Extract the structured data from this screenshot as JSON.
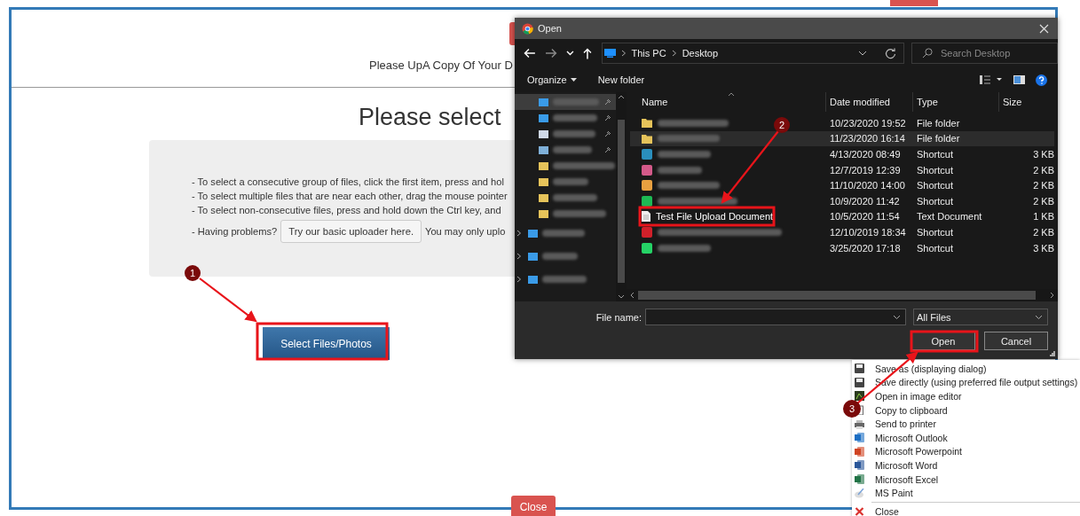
{
  "page": {
    "header_text": "Please UpA Copy Of Your D",
    "heading": "Please select",
    "instructions": [
      "- To select a consecutive group of files, click the first item, press and hol",
      "- To select multiple files that are near each other, drag the mouse pointer",
      "- To select non-consecutive files, press and hold down the Ctrl key, and"
    ],
    "problems_label": "- Having problems?",
    "basic_uploader_button": "Try our basic uploader here.",
    "problems_note": "You may only uplo",
    "select_button": "Select Files/Photos",
    "close_button": "Close"
  },
  "dialog": {
    "title": "Open",
    "breadcrumb": [
      "This PC",
      "Desktop"
    ],
    "search": {
      "placeholder": "Search Desktop"
    },
    "toolbar": {
      "organize": "Organize",
      "new_folder": "New folder"
    },
    "nav_pane": [
      {
        "kind": "desktop",
        "selected": true,
        "pinned": true,
        "expandable": false
      },
      {
        "kind": "downloads",
        "selected": false,
        "pinned": true,
        "expandable": false
      },
      {
        "kind": "documents",
        "selected": false,
        "pinned": true,
        "expandable": false
      },
      {
        "kind": "pictures",
        "selected": false,
        "pinned": true,
        "expandable": false
      },
      {
        "kind": "folder",
        "selected": false,
        "pinned": false,
        "expandable": false
      },
      {
        "kind": "folder",
        "selected": false,
        "pinned": false,
        "expandable": false
      },
      {
        "kind": "folder",
        "selected": false,
        "pinned": false,
        "expandable": false
      },
      {
        "kind": "folder",
        "selected": false,
        "pinned": false,
        "expandable": false
      },
      {
        "kind": "cloud",
        "selected": false,
        "pinned": false,
        "expandable": true
      },
      {
        "kind": "pc",
        "selected": false,
        "pinned": false,
        "expandable": true
      },
      {
        "kind": "network",
        "selected": false,
        "pinned": false,
        "expandable": true
      }
    ],
    "columns": [
      "Name",
      "Date modified",
      "Type",
      "Size"
    ],
    "files": [
      {
        "kind": "folder",
        "date": "10/23/2020 19:52",
        "type": "File folder",
        "hovered": false
      },
      {
        "kind": "folder",
        "date": "11/23/2020 16:14",
        "type": "File folder",
        "hovered": true
      },
      {
        "kind": "shortcut",
        "color": "#2a8fbd",
        "date": "4/13/2020 08:49",
        "type": "Shortcut",
        "size": "3 KB",
        "hovered": false
      },
      {
        "kind": "shortcut",
        "color": "#d45a8a",
        "date": "12/7/2019 12:39",
        "type": "Shortcut",
        "size": "2 KB",
        "hovered": false
      },
      {
        "kind": "shortcut",
        "color": "#e8a040",
        "date": "11/10/2020 14:00",
        "type": "Shortcut",
        "size": "2 KB",
        "hovered": false
      },
      {
        "kind": "shortcut",
        "color": "#1db954",
        "date": "10/9/2020 11:42",
        "type": "Shortcut",
        "size": "2 KB",
        "hovered": false
      },
      {
        "kind": "text",
        "name": "Test File Upload Document",
        "date": "10/5/2020 11:54",
        "type": "Text Document",
        "size": "1 KB",
        "hovered": false
      },
      {
        "kind": "shortcut",
        "color": "#d0202a",
        "date": "12/10/2019 18:34",
        "type": "Shortcut",
        "size": "2 KB",
        "hovered": false
      },
      {
        "kind": "shortcut",
        "color": "#25d366",
        "date": "3/25/2020 17:18",
        "type": "Shortcut",
        "size": "3 KB",
        "hovered": false
      }
    ],
    "file_name_label": "File name:",
    "file_type": "All Files",
    "buttons": [
      "Open",
      "Cancel"
    ]
  },
  "context_menu": [
    {
      "kind": "disk",
      "label": "Save as (displaying dialog)"
    },
    {
      "kind": "disk",
      "label": "Save directly (using preferred file output settings)"
    },
    {
      "kind": "editor",
      "label": "Open in image editor"
    },
    {
      "kind": "clipboard",
      "label": "Copy to clipboard"
    },
    {
      "kind": "printer",
      "label": "Send to printer"
    },
    {
      "kind": "outlook",
      "label": "Microsoft Outlook"
    },
    {
      "kind": "powerpoint",
      "label": "Microsoft Powerpoint"
    },
    {
      "kind": "word",
      "label": "Microsoft Word"
    },
    {
      "kind": "excel",
      "label": "Microsoft Excel"
    },
    {
      "kind": "paint",
      "label": "MS Paint"
    },
    {
      "kind": "separator"
    },
    {
      "kind": "close",
      "label": "Close"
    }
  ],
  "annotations": [
    {
      "number": "1"
    },
    {
      "number": "2"
    },
    {
      "number": "3"
    }
  ]
}
